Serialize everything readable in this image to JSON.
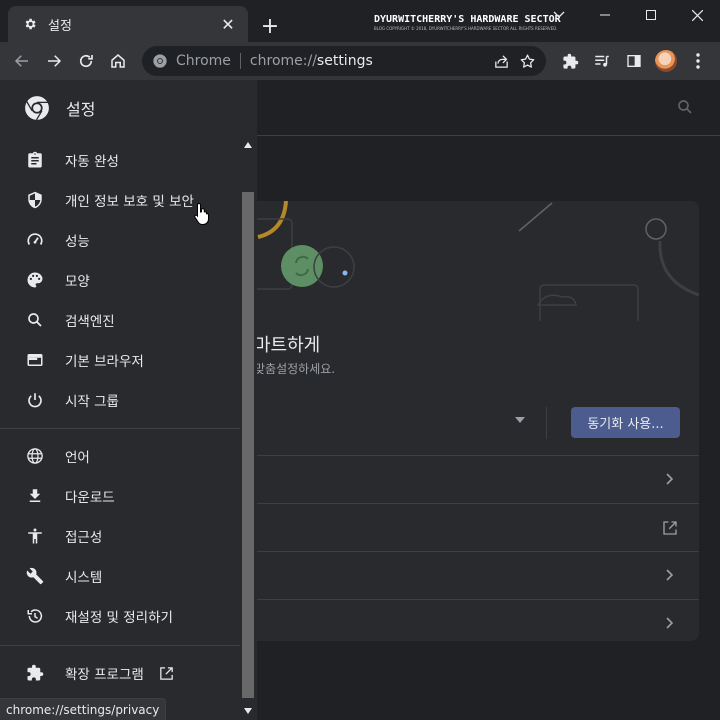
{
  "tab": {
    "title": "설정",
    "close_glyph": "✕"
  },
  "newtab_glyph": "+",
  "watermark": {
    "title": "DYURWITCHERRY'S HARDWARE SECTOR",
    "subtitle": "BLOG COPYRIGHT © 2018, DYURWITCHERRY'S HARDWARE SECTOR ALL RIGHTS RESERVED."
  },
  "omnibox": {
    "chip": "Chrome",
    "url_scheme": "chrome://",
    "url_path": "settings"
  },
  "drawer": {
    "title": "설정",
    "items": [
      {
        "label": "자동 완성",
        "icon": "clipboard-icon"
      },
      {
        "label": "개인 정보 보호 및 보안",
        "icon": "shield-icon"
      },
      {
        "label": "성능",
        "icon": "speedometer-icon"
      },
      {
        "label": "모양",
        "icon": "palette-icon"
      },
      {
        "label": "검색엔진",
        "icon": "search-icon"
      },
      {
        "label": "기본 브라우저",
        "icon": "browser-icon"
      },
      {
        "label": "시작 그룹",
        "icon": "power-icon"
      },
      {
        "label": "언어",
        "icon": "globe-icon"
      },
      {
        "label": "다운로드",
        "icon": "download-icon"
      },
      {
        "label": "접근성",
        "icon": "accessibility-icon"
      },
      {
        "label": "시스템",
        "icon": "wrench-icon"
      },
      {
        "label": "재설정 및 정리하기",
        "icon": "history-icon"
      },
      {
        "label": "확장 프로그램",
        "icon": "puzzle-icon"
      }
    ]
  },
  "main": {
    "hero_title_partial": "마트하게",
    "hero_subtitle_partial": "맞춤설정하세요.",
    "sync_button": "동기화 사용..."
  },
  "status_url": "chrome://settings/privacy",
  "colors": {
    "accent": "#8ab4f8",
    "sync_button": "#4d5c8e",
    "drawer_bg": "#292a2d",
    "page_bg": "#202124"
  }
}
